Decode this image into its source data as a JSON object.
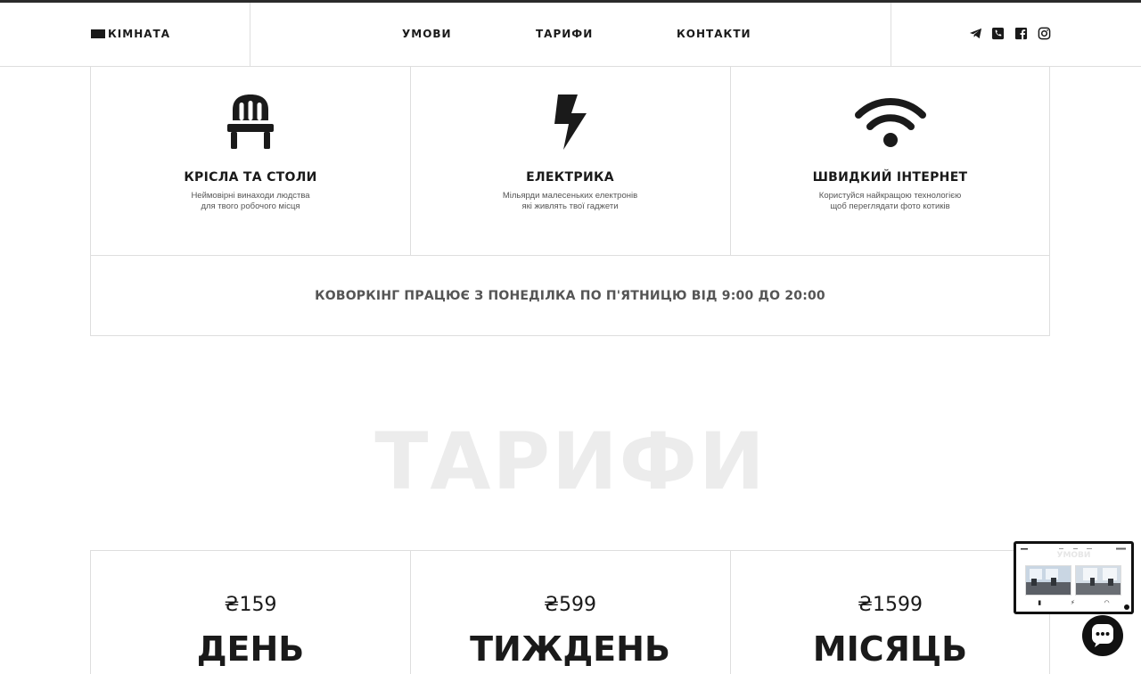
{
  "header": {
    "logo": "КІМНАТА",
    "nav": [
      "УМОВИ",
      "ТАРИФИ",
      "КОНТАКТИ"
    ],
    "social": [
      "telegram-icon",
      "phone-icon",
      "facebook-icon",
      "instagram-icon"
    ]
  },
  "features": [
    {
      "icon": "chair-icon",
      "title": "КРІСЛА ТА СТОЛИ",
      "desc1": "Неймовірні винаходи людства",
      "desc2": "для твого робочого місця"
    },
    {
      "icon": "lightning-icon",
      "title": "ЕЛЕКТРИКА",
      "desc1": "Мільярди малесеньких електронів",
      "desc2": "які живлять твої гаджети"
    },
    {
      "icon": "wifi-icon",
      "title": "ШВИДКИЙ ІНТЕРНЕТ",
      "desc1": "Користуйся найкращою технологією",
      "desc2": "щоб переглядати фото котиків"
    }
  ],
  "hours": "КОВОРКІНГ ПРАЦЮЄ З ПОНЕДІЛКА ПО П'ЯТНИЦЮ ВІД 9:00 ДО 20:00",
  "tariffs_title": "ТАРИФИ",
  "tariffs": [
    {
      "price": "₴159",
      "period": "ДЕНЬ"
    },
    {
      "price": "₴599",
      "period": "ТИЖДЕНЬ"
    },
    {
      "price": "₴1599",
      "period": "МІСЯЦЬ"
    }
  ],
  "preview": {
    "title": "УМОВИ"
  },
  "colors": {
    "text": "#1a1a1a",
    "muted": "#555555",
    "border": "#dedede",
    "watermark": "#ececec"
  }
}
